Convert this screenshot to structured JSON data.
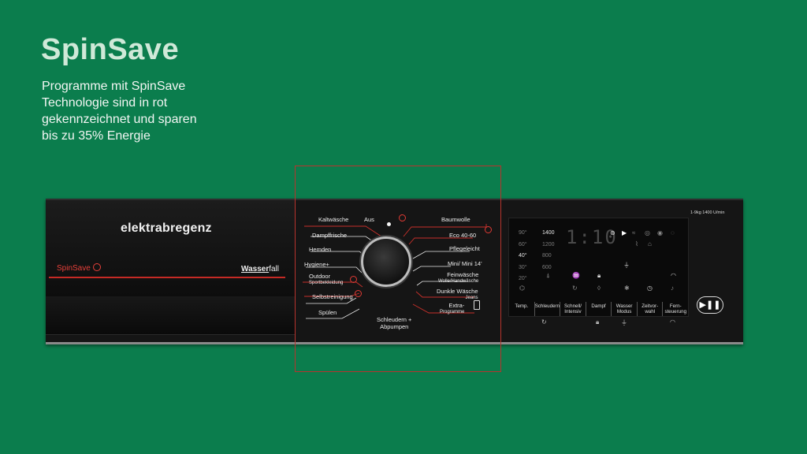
{
  "hero": {
    "title": "SpinSave",
    "lines": [
      "Programme mit SpinSave",
      "Technologie sind in rot",
      "gekennzeichnet und sparen",
      "bis zu 35% Energie"
    ]
  },
  "panel": {
    "brand": "elektrabregenz",
    "badge": "SpinSave",
    "feature_prefix": "Wasser",
    "feature_suffix": "fall",
    "capacity": "1-9kg 1400 U/min"
  },
  "programs": {
    "off": "Aus",
    "left": [
      "Kaltwäsche",
      "Dampffrische",
      "Hemden",
      "Hygiene+",
      "Outdoor",
      "Selbstreinigung",
      "Spülen"
    ],
    "outdoor_sub": "Sportbekleidung",
    "right": [
      "Baumwolle",
      "Eco 40-60",
      "Pflegeleicht",
      "Mini/ Mini 14'",
      "Feinwäsche",
      "Dunkle Wäsche",
      "Extra-"
    ],
    "feinwaesche_sub": "Wolle/Handwäsche",
    "dunkle_sub": "Jeans",
    "extra_sub": "Programme",
    "bottom_1": "Schleudern +",
    "bottom_2": "Abpumpen"
  },
  "display": {
    "temps": [
      "90°",
      "60°",
      "40°",
      "30°",
      "20°"
    ],
    "active_temp": "40°",
    "speeds": [
      "1400",
      "1200",
      "800",
      "600"
    ],
    "active_speed": "1400",
    "time": "1:10",
    "functions": [
      [
        "Temp.",
        ""
      ],
      [
        "Schleudern",
        ""
      ],
      [
        "Schnell/",
        "Intensiv"
      ],
      [
        "Dampf",
        ""
      ],
      [
        "Wasser",
        "Modus"
      ],
      [
        "Zeitvor-",
        "wahl"
      ],
      [
        "Fern-",
        "steuerung"
      ]
    ]
  },
  "colors": {
    "background": "#0b7d4d",
    "spinsave_red": "#c52a25",
    "panel": "#151515"
  }
}
